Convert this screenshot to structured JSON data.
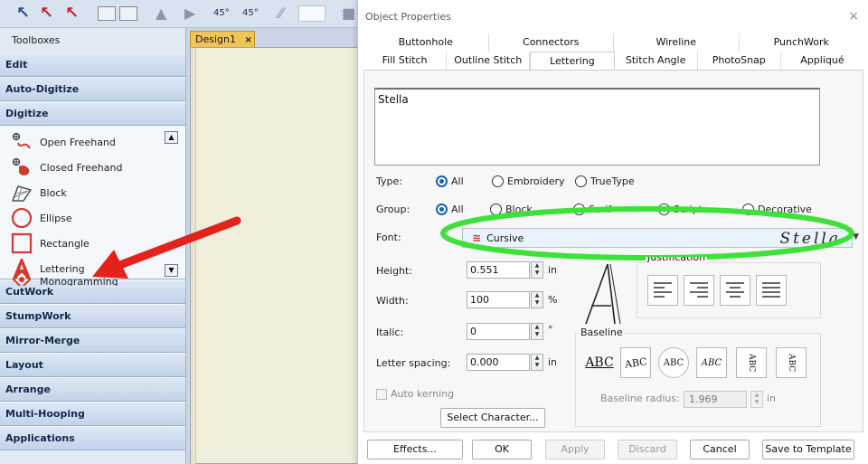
{
  "toolbar": {
    "angle_a": "45°",
    "angle_b": "45°"
  },
  "toolboxes": {
    "title": "Toolboxes",
    "categories_top": [
      "Edit",
      "Auto-Digitize",
      "Digitize"
    ],
    "tools": [
      {
        "label": "Open Freehand",
        "icon": "open-freehand-icon"
      },
      {
        "label": "Closed Freehand",
        "icon": "closed-freehand-icon"
      },
      {
        "label": "Block",
        "icon": "block-icon"
      },
      {
        "label": "Ellipse",
        "icon": "ellipse-icon"
      },
      {
        "label": "Rectangle",
        "icon": "rectangle-icon"
      },
      {
        "label": "Lettering",
        "icon": "lettering-icon"
      },
      {
        "label": "Monogramming",
        "icon": "monogramming-icon"
      }
    ],
    "categories_bottom": [
      "CutWork",
      "StumpWork",
      "Mirror-Merge",
      "Layout",
      "Arrange",
      "Multi-Hooping",
      "Applications"
    ]
  },
  "document": {
    "tab_label": "Design1",
    "tab_close": "×"
  },
  "dialog": {
    "title": "Object Properties",
    "close": "×",
    "tabs_row1": [
      "Buttonhole",
      "Connectors",
      "Wireline",
      "PunchWork"
    ],
    "tabs_row2": [
      "Fill Stitch",
      "Outline Stitch",
      "Lettering",
      "Stitch Angle",
      "PhotoSnap",
      "Appliqué"
    ],
    "text_value": "Stella",
    "type": {
      "label": "Type:",
      "options": [
        "All",
        "Embroidery",
        "TrueType"
      ],
      "selected": "All"
    },
    "group": {
      "label": "Group:",
      "options": [
        "All",
        "Block",
        "Serif",
        "Script",
        "Decorative"
      ],
      "selected": "All"
    },
    "font": {
      "label": "Font:",
      "value": "Cursive",
      "preview": "Stella"
    },
    "height": {
      "label": "Height:",
      "value": "0.551",
      "unit": "in"
    },
    "width": {
      "label": "Width:",
      "value": "100",
      "unit": "%"
    },
    "italic": {
      "label": "Italic:",
      "value": "0",
      "unit": "°"
    },
    "letter_spacing": {
      "label": "Letter spacing:",
      "value": "0.000",
      "unit": "in"
    },
    "auto_kerning": "Auto kerning",
    "select_character": "Select Character...",
    "justification_title": "Justification",
    "baseline_title": "Baseline",
    "baseline_icons": [
      "ABC",
      "ABC",
      "ABC",
      "ABC",
      "ABC",
      "ABC"
    ],
    "baseline_radius": {
      "label": "Baseline radius:",
      "value": "1.969",
      "unit": "in"
    },
    "buttons": {
      "effects": "Effects...",
      "ok": "OK",
      "apply": "Apply",
      "discard": "Discard",
      "cancel": "Cancel",
      "save_template": "Save to Template"
    }
  },
  "colors": {
    "arrow": "#e3231b",
    "highlight": "#3ee03a",
    "radio_accent": "#1a5fb4"
  }
}
